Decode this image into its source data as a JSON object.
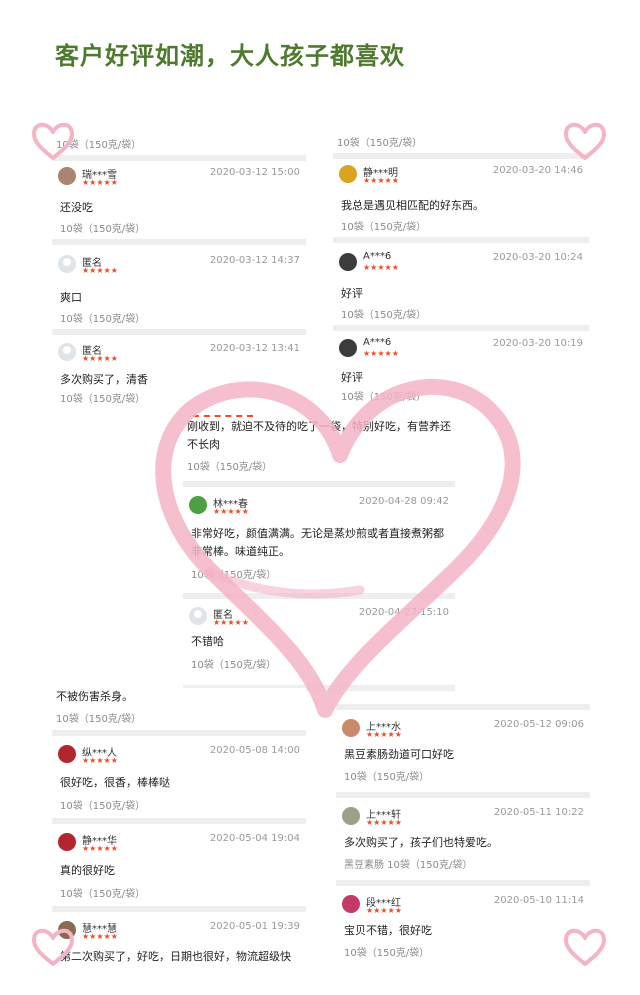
{
  "title": "客户好评如潮，大人孩子都喜欢",
  "star_text": "★★★★★",
  "colors": {
    "title": "#4e7a2e",
    "stars": "#e5502d",
    "heart": "#f4b4c4"
  },
  "left_col": {
    "top_spec": "10袋（150克/袋）",
    "reviews": [
      {
        "user": "瑞***雪",
        "date": "2020-03-12 15:00",
        "text": "还没吃",
        "spec": "10袋（150克/袋）",
        "avatar": "user-avatar"
      },
      {
        "user": "匿名",
        "date": "2020-03-12 14:37",
        "text": "爽口",
        "spec": "10袋（150克/袋）",
        "avatar": "anonymous-avatar"
      },
      {
        "user": "匿名",
        "date": "2020-03-12 13:41",
        "text": "多次购买了，清香",
        "spec": "10袋（150克/袋）",
        "avatar": "anonymous-avatar"
      }
    ]
  },
  "right_col": {
    "top_spec": "10袋（150克/袋）",
    "reviews": [
      {
        "user": "静***明",
        "date": "2020-03-20 14:46",
        "text": "我总是遇见相匹配的好东西。",
        "spec": "10袋（150克/袋）",
        "avatar": "user-avatar"
      },
      {
        "user": "A***6",
        "date": "2020-03-20 10:24",
        "text": "好评",
        "spec": "10袋（150克/袋）",
        "avatar": "user-avatar"
      },
      {
        "user": "A***6",
        "date": "2020-03-20 10:19",
        "text": "好评",
        "spec": "10袋（150克/袋）",
        "avatar": "user-avatar"
      }
    ]
  },
  "center_col": {
    "top_text": "刚收到，就迫不及待的吃了一袋，特别好吃，有营养还不长肉",
    "top_spec": "10袋（150克/袋）",
    "reviews": [
      {
        "user": "林***春",
        "date": "2020-04-28 09:42",
        "text": "非常好吃，颜值满满。无论是蒸炒煎或者直接煮粥都非常棒。味道纯正。",
        "spec": "10袋（150克/袋）",
        "avatar": "user-avatar"
      },
      {
        "user": "匿名",
        "date": "2020-04-27 15:10",
        "text": "不错哈",
        "spec": "10袋（150克/袋）",
        "avatar": "anonymous-avatar"
      }
    ]
  },
  "bottom_left": {
    "top_text": "不被伤害杀身。",
    "top_spec": "10袋（150克/袋）",
    "reviews": [
      {
        "user": "纵***人",
        "date": "2020-05-08 14:00",
        "text": "很好吃，很香，棒棒哒",
        "spec": "10袋（150克/袋）",
        "avatar": "user-avatar"
      },
      {
        "user": "静***华",
        "date": "2020-05-04 19:04",
        "text": "真的很好吃",
        "spec": "10袋（150克/袋）",
        "avatar": "user-avatar"
      },
      {
        "user": "慧***慧",
        "date": "2020-05-01 19:39",
        "text": "第二次购买了，好吃，日期也很好，物流超级快",
        "spec": "",
        "avatar": "user-avatar"
      }
    ]
  },
  "bottom_right": {
    "reviews": [
      {
        "user": "上***水",
        "date": "2020-05-12 09:06",
        "text": "黑豆素肠劲道可口好吃",
        "spec": "10袋（150克/袋）",
        "avatar": "user-avatar"
      },
      {
        "user": "上***轩",
        "date": "2020-05-11 10:22",
        "text": "多次购买了，孩子们也特爱吃。",
        "spec": "黑豆素肠 10袋（150克/袋）",
        "avatar": "user-avatar"
      },
      {
        "user": "段***红",
        "date": "2020-05-10 11:14",
        "text": "宝贝不错，很好吃",
        "spec": "10袋（150克/袋）",
        "avatar": "user-avatar"
      }
    ]
  }
}
